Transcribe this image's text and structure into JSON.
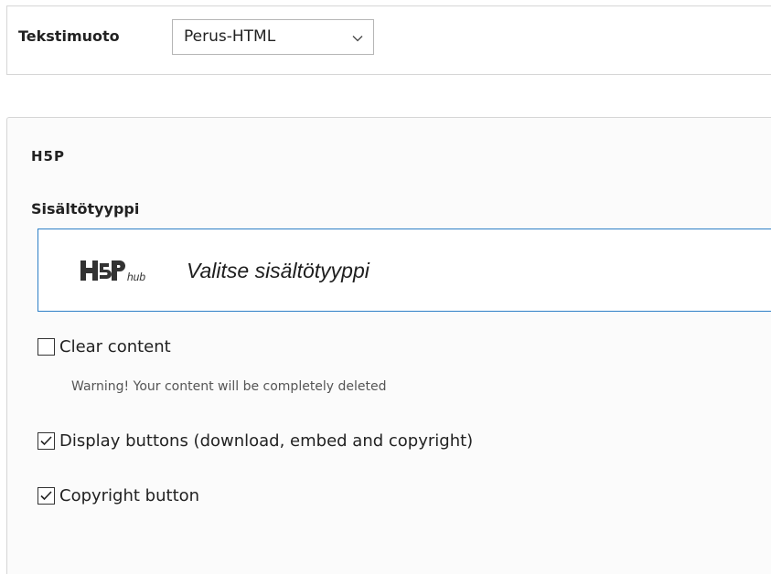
{
  "text_format": {
    "label": "Tekstimuoto",
    "selected": "Perus-HTML",
    "chevron_icon": "chevron-down-icon"
  },
  "h5p": {
    "title": "H5P",
    "content_type_label": "Sisältötyyppi",
    "hub": {
      "logo_icon": "h5p-hub-logo",
      "placeholder": "Valitse sisältötyyppi",
      "accent_color": "#2e7fc6"
    },
    "options": [
      {
        "label": "Clear content",
        "checked": false,
        "description": "Warning! Your content will be completely deleted"
      },
      {
        "label": "Display buttons (download, embed and copyright)",
        "checked": true
      },
      {
        "label": "Copyright button",
        "checked": true
      }
    ]
  }
}
